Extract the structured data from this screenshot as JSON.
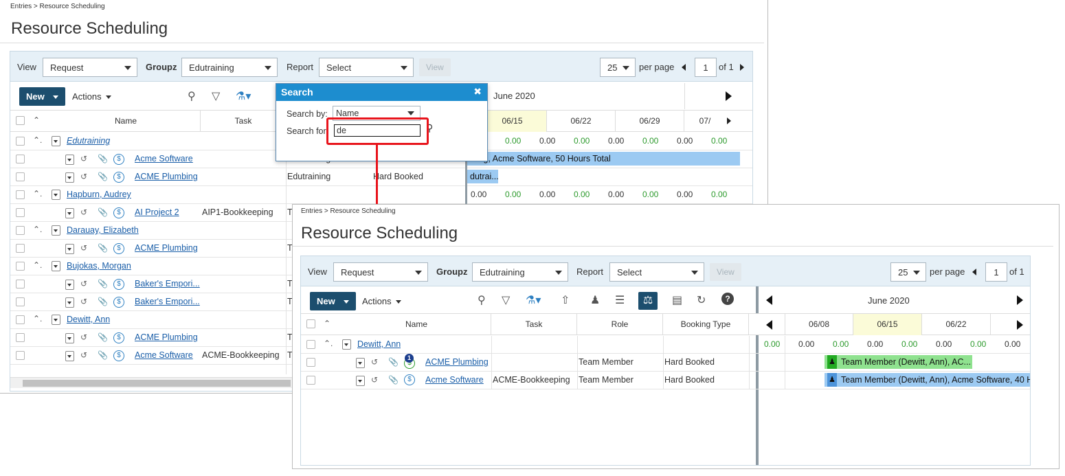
{
  "breadcrumb": "Entries > Resource Scheduling",
  "page_title": "Resource Scheduling",
  "toolbar": {
    "view_label": "View",
    "view_value": "Request",
    "groupz_label": "Groupz",
    "groupz_value": "Edutraining",
    "report_label": "Report",
    "report_value": "Select",
    "view_button": "View",
    "per_page_value": "25",
    "per_page_label": "per page",
    "page_value": "1",
    "page_of": "of 1",
    "new_button": "New",
    "actions_label": "Actions"
  },
  "columns": {
    "name": "Name",
    "task": "Task",
    "role": "Role",
    "booking_type": "Booking Type"
  },
  "calendar": {
    "month": "June 2020"
  },
  "search_dialog": {
    "title": "Search",
    "search_by_label": "Search by:",
    "search_by_value": "Name",
    "search_for_label": "Search for:",
    "search_for_value": "de"
  },
  "back_panel": {
    "dates": [
      "06/15",
      "06/22",
      "06/29",
      "07/"
    ],
    "rows": [
      {
        "type": "group",
        "name": "Edutraining",
        "italic": true
      },
      {
        "type": "item",
        "name": "Acme Software",
        "task": "",
        "extra": "Edutraining",
        "booking": "Hard Booked"
      },
      {
        "type": "item",
        "name": "ACME Plumbing",
        "task": "",
        "extra": "Edutraining",
        "booking": "Hard Booked"
      },
      {
        "type": "group",
        "name": "Hapburn, Audrey"
      },
      {
        "type": "item",
        "name": "AI Project 2",
        "task": "AIP1-Bookkeeping",
        "extra": "T"
      },
      {
        "type": "group",
        "name": "Darauay, Elizabeth"
      },
      {
        "type": "item",
        "name": "ACME Plumbing",
        "task": "",
        "extra": "T"
      },
      {
        "type": "group",
        "name": "Bujokas, Morgan"
      },
      {
        "type": "item",
        "name": "Baker's Empori...",
        "task": "",
        "extra": "T"
      },
      {
        "type": "item",
        "name": "Baker's Empori...",
        "task": "",
        "extra": "T"
      },
      {
        "type": "group",
        "name": "Dewitt, Ann"
      },
      {
        "type": "item",
        "name": "ACME Plumbing",
        "task": "",
        "extra": "T"
      },
      {
        "type": "item",
        "name": "Acme Software",
        "task": "ACME-Bookkeeping",
        "extra": "T"
      }
    ],
    "zero": "0.00",
    "bar1": "ining, Acme Software, 50 Hours Total",
    "bar2": "dutrai..."
  },
  "front_panel": {
    "dates": [
      "06/08",
      "06/15",
      "06/22"
    ],
    "group_name": "Dewitt, Ann",
    "zero": "0.00",
    "rows": [
      {
        "name": "ACME Plumbing",
        "task": "",
        "role": "Team Member",
        "booking": "Hard Booked",
        "bar": "Team Member (Dewitt, Ann), AC..."
      },
      {
        "name": "Acme Software",
        "task": "ACME-Bookkeeping",
        "role": "Team Member",
        "booking": "Hard Booked",
        "bar": "Team Member (Dewitt, Ann), Acme Software, 40 H"
      }
    ]
  },
  "colors": {
    "accent": "#1c4e6e",
    "highlight": "#e8141c",
    "bar_blue": "#9ccaf2",
    "bar_green": "#8fe28f"
  }
}
